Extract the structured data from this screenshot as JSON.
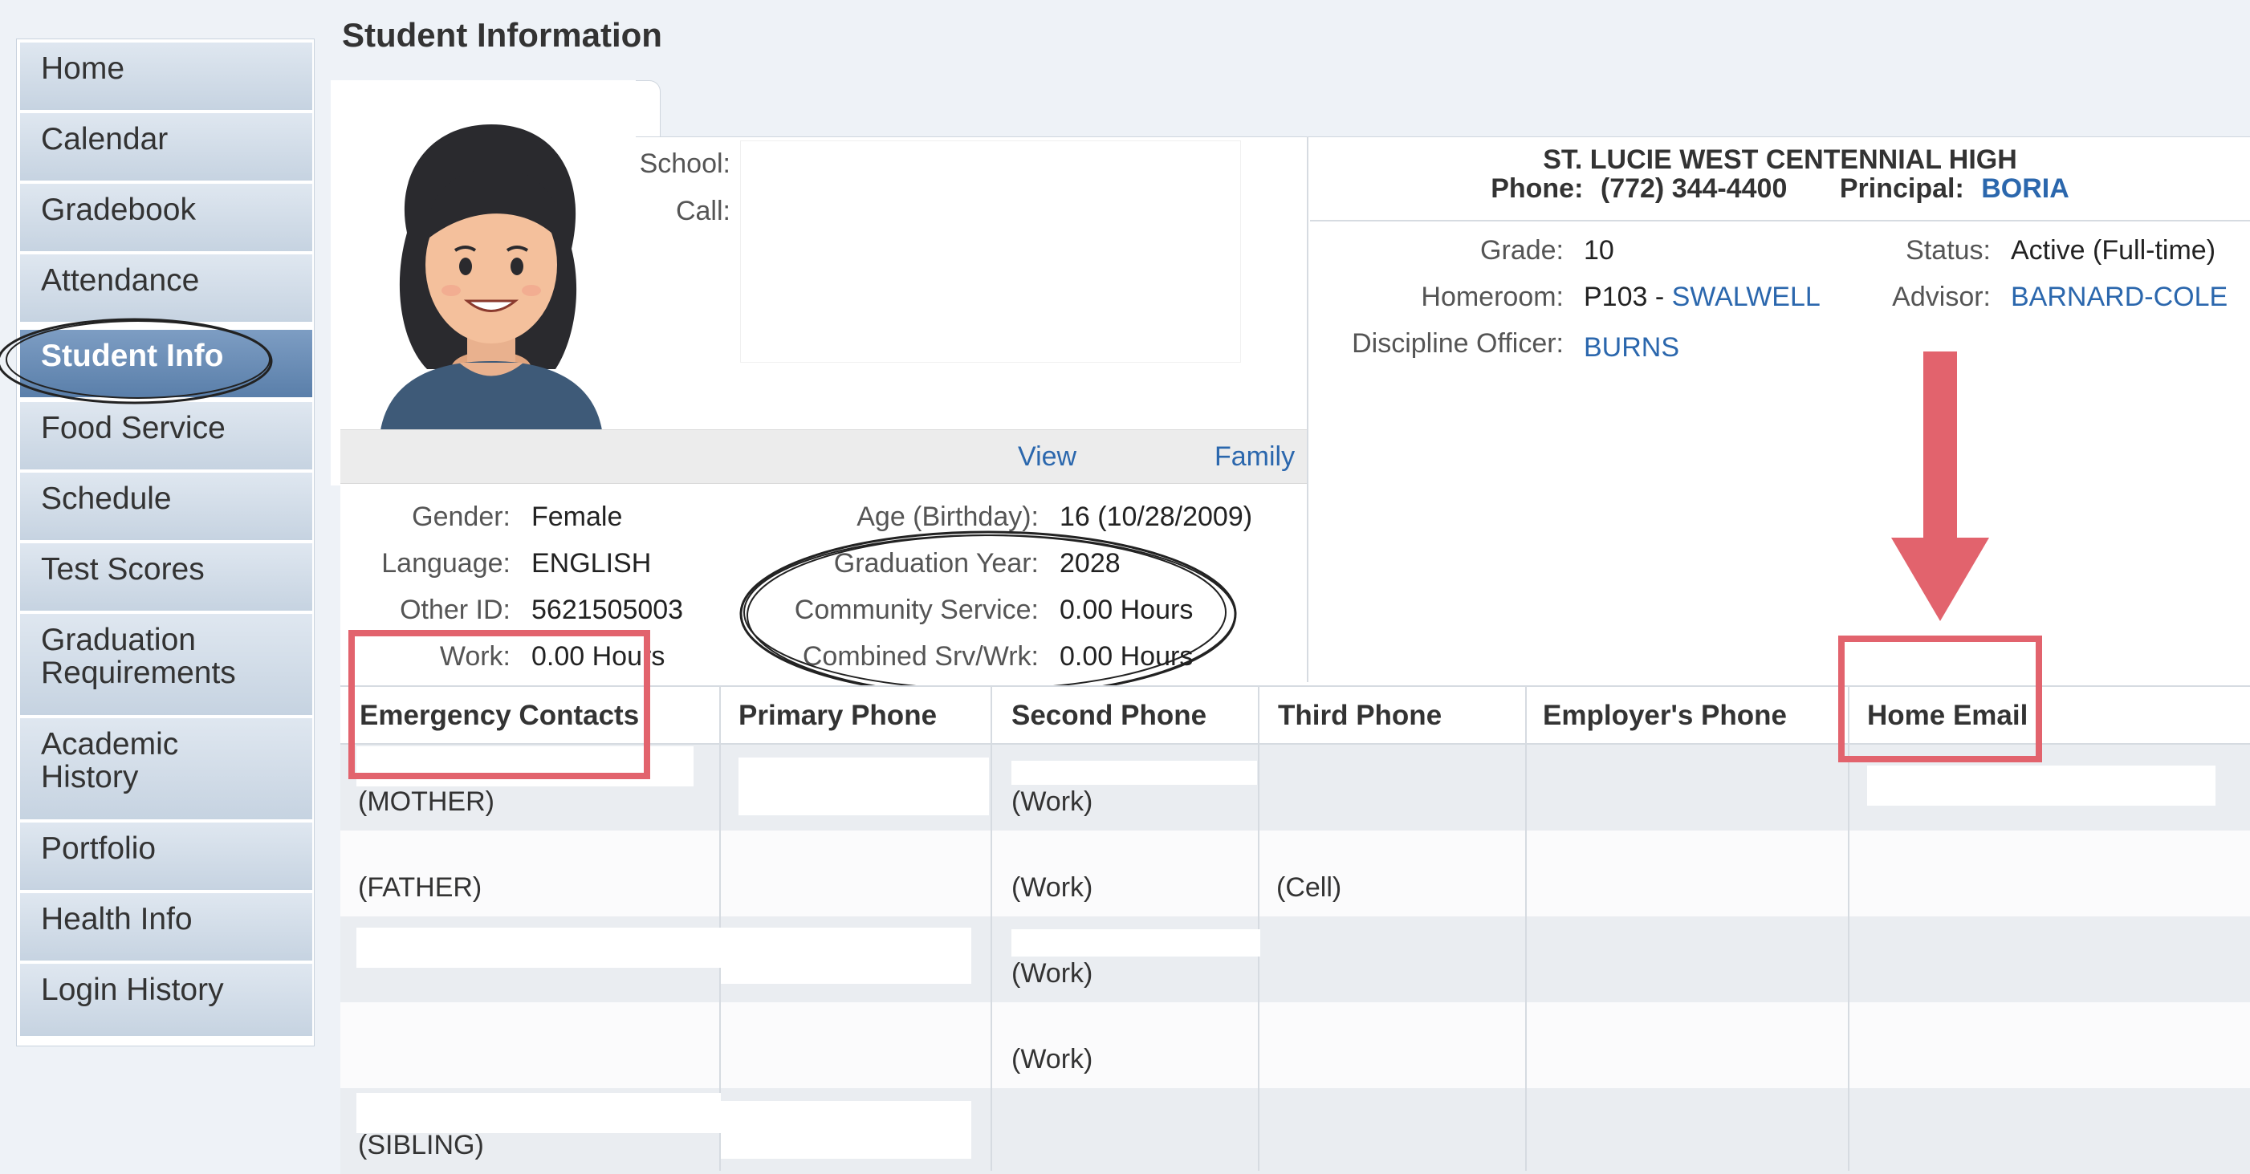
{
  "page_title": "Student Information",
  "sidebar": {
    "items": [
      {
        "label": "Home"
      },
      {
        "label": "Calendar"
      },
      {
        "label": "Gradebook"
      },
      {
        "label": "Attendance"
      },
      {
        "label": "Student Info",
        "active": true
      },
      {
        "label": "Food Service"
      },
      {
        "label": "Schedule"
      },
      {
        "label": "Test Scores"
      },
      {
        "label": "Graduation",
        "label2": "Requirements"
      },
      {
        "label": "Academic",
        "label2": "History"
      },
      {
        "label": "Portfolio"
      },
      {
        "label": "Health Info"
      },
      {
        "label": "Login History"
      }
    ]
  },
  "contact_labels": {
    "school": "School:",
    "call": "Call:"
  },
  "view_bar": {
    "view": "View",
    "family": "Family"
  },
  "details": {
    "gender_label": "Gender:",
    "gender": "Female",
    "language_label": "Language:",
    "language": "ENGLISH",
    "other_id_label": "Other ID:",
    "other_id": "5621505003",
    "work_label": "Work:",
    "work": "0.00 Hours",
    "age_label": "Age (Birthday):",
    "age": "16 (10/28/2009)",
    "grad_year_label": "Graduation Year:",
    "grad_year": "2028",
    "community_label": "Community Service:",
    "community": "0.00 Hours",
    "combined_label": "Combined Srv/Wrk:",
    "combined": "0.00 Hours"
  },
  "school": {
    "name": "ST. LUCIE WEST CENTENNIAL HIGH",
    "phone_label": "Phone:",
    "phone": "(772) 344-4400",
    "principal_label": "Principal:",
    "principal": "BORIA",
    "grade_label": "Grade:",
    "grade": "10",
    "homeroom_label": "Homeroom:",
    "homeroom_room": "P103 - ",
    "homeroom_teacher": "SWALWELL",
    "discipline_label": "Discipline Officer:",
    "discipline": "BURNS",
    "status_label": "Status:",
    "status": "Active (Full-time)",
    "advisor_label": "Advisor:",
    "advisor": "BARNARD-COLE"
  },
  "contacts": {
    "headers": [
      "Emergency Contacts",
      "Primary Phone",
      "Second Phone",
      "Third Phone",
      "Employer's Phone",
      "Home Email"
    ],
    "rows": [
      {
        "relation": "(MOTHER)",
        "second": "(Work)",
        "third": ""
      },
      {
        "relation": "(FATHER)",
        "second": "(Work)",
        "third": "(Cell)"
      },
      {
        "relation": "",
        "second": "(Work)",
        "third": ""
      },
      {
        "relation": "",
        "second": "(Work)",
        "third": ""
      },
      {
        "relation": "(SIBLING)",
        "second": "",
        "third": ""
      }
    ]
  },
  "colors": {
    "annotation_red": "#e2636d",
    "link_blue": "#2b67ad",
    "active_nav": "#5a7faa"
  }
}
